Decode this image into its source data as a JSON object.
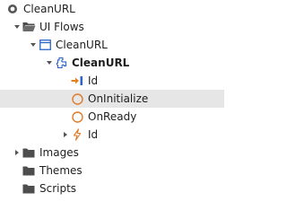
{
  "tree": {
    "root": {
      "label": "CleanURL",
      "icon": "module-circle-icon"
    },
    "ui_flows": {
      "label": "UI Flows",
      "icon": "folder-open-icon",
      "expanded": true
    },
    "flow": {
      "label": "CleanURL",
      "icon": "window-screen-icon",
      "expanded": true
    },
    "screen": {
      "label": "CleanURL",
      "icon": "web-block-icon",
      "expanded": true
    },
    "id_input": {
      "label": "Id",
      "icon": "input-parameter-icon"
    },
    "on_initialize": {
      "label": "OnInitialize",
      "icon": "event-circle-icon",
      "selected": true
    },
    "on_ready": {
      "label": "OnReady",
      "icon": "event-circle-icon"
    },
    "id_local": {
      "label": "Id",
      "icon": "lightning-icon",
      "expanded": false
    },
    "images": {
      "label": "Images",
      "icon": "folder-icon",
      "expanded": false
    },
    "themes": {
      "label": "Themes",
      "icon": "folder-icon"
    },
    "scripts": {
      "label": "Scripts",
      "icon": "folder-icon"
    }
  },
  "colors": {
    "selection": "#e6e6e6",
    "event_orange": "#e07b2a",
    "input_blue": "#2a63c9",
    "arrow_orange": "#e0821e",
    "folder_gray": "#4d4d4d"
  }
}
